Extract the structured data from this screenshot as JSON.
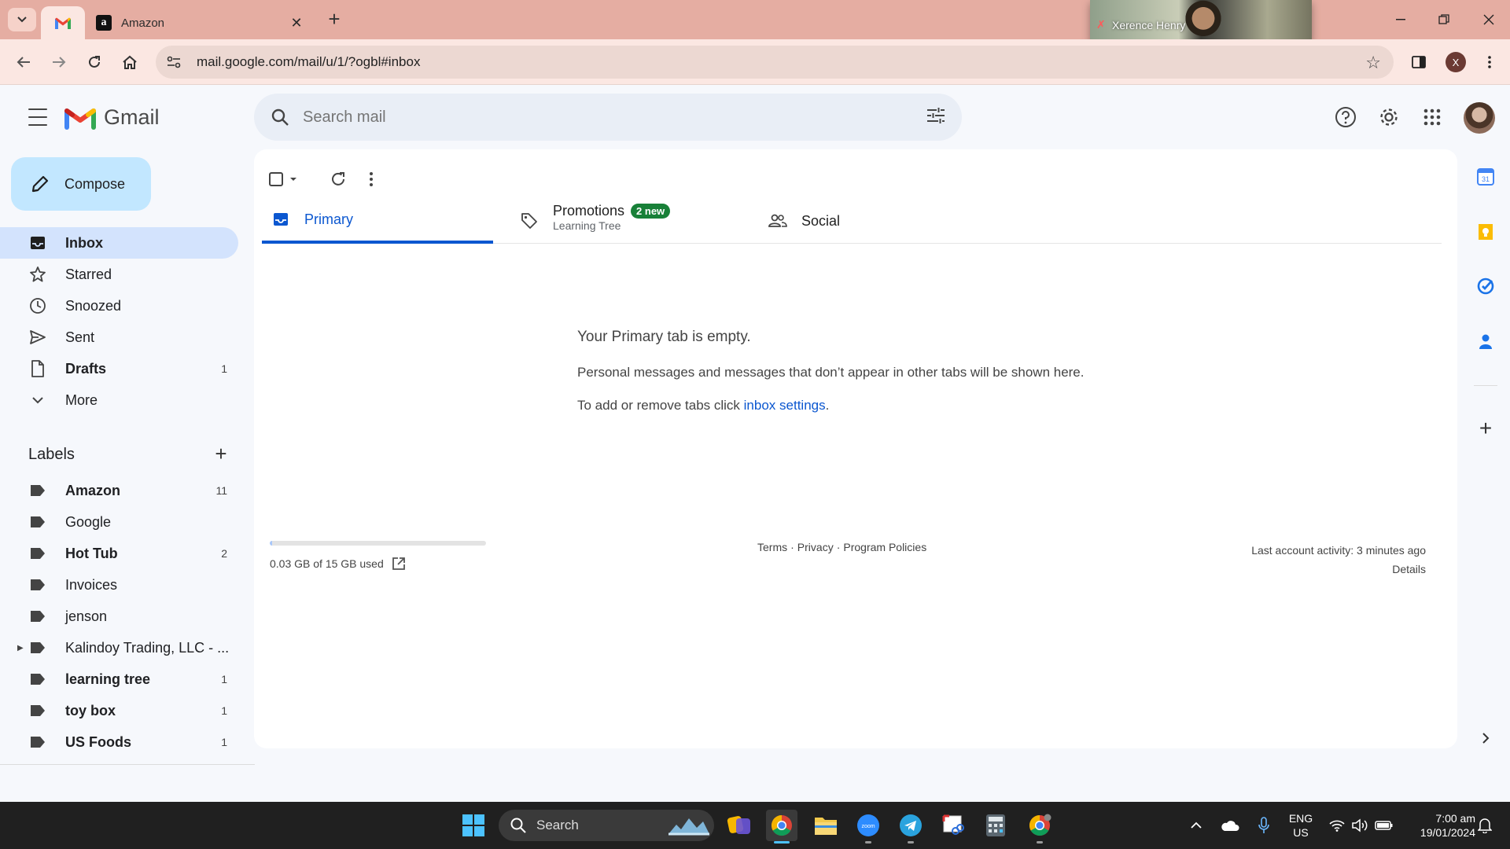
{
  "browser": {
    "tabs": [
      {
        "title": "",
        "favicon": "gmail-icon",
        "active": true
      },
      {
        "title": "Amazon",
        "favicon": "amazon-icon",
        "active": false
      }
    ],
    "new_tab": "+",
    "url": "mail.google.com/mail/u/1/?ogbl#inbox",
    "profile_initial": "X",
    "video_call_name": "Xerence Henry"
  },
  "gmail": {
    "logo_text": "Gmail",
    "search_placeholder": "Search mail",
    "compose_label": "Compose",
    "nav": [
      {
        "label": "Inbox",
        "count": "",
        "icon": "inbox-icon",
        "active": true,
        "bold": true
      },
      {
        "label": "Starred",
        "count": "",
        "icon": "star-icon",
        "active": false,
        "bold": false
      },
      {
        "label": "Snoozed",
        "count": "",
        "icon": "clock-icon",
        "active": false,
        "bold": false
      },
      {
        "label": "Sent",
        "count": "",
        "icon": "send-icon",
        "active": false,
        "bold": false
      },
      {
        "label": "Drafts",
        "count": "1",
        "icon": "draft-icon",
        "active": false,
        "bold": true
      },
      {
        "label": "More",
        "count": "",
        "icon": "chevron-down-icon",
        "active": false,
        "bold": false
      }
    ],
    "labels_title": "Labels",
    "labels": [
      {
        "label": "Amazon",
        "count": "11",
        "bold": true
      },
      {
        "label": "Google",
        "count": "",
        "bold": false
      },
      {
        "label": "Hot Tub",
        "count": "2",
        "bold": true
      },
      {
        "label": "Invoices",
        "count": "",
        "bold": false
      },
      {
        "label": "jenson",
        "count": "",
        "bold": false
      },
      {
        "label": "Kalindoy Trading, LLC - ...",
        "count": "",
        "bold": false,
        "expandable": true
      },
      {
        "label": "learning tree",
        "count": "1",
        "bold": true
      },
      {
        "label": "toy box",
        "count": "1",
        "bold": false
      },
      {
        "label": "US Foods",
        "count": "1",
        "bold": false
      }
    ],
    "category_tabs": [
      {
        "label": "Primary",
        "icon": "inbox-icon",
        "active": true
      },
      {
        "label": "Promotions",
        "icon": "tag-icon",
        "badge": "2 new",
        "subline": "Learning Tree"
      },
      {
        "label": "Social",
        "icon": "people-icon"
      }
    ],
    "empty_state": {
      "title": "Your Primary tab is empty.",
      "line1": "Personal messages and messages that don’t appear in other tabs will be shown here.",
      "line2_prefix": "To add or remove tabs click ",
      "line2_link": "inbox settings",
      "line2_suffix": "."
    },
    "footer": {
      "storage": "0.03 GB of 15 GB used",
      "storage_fraction": 0.002,
      "links": [
        "Terms",
        "Privacy",
        "Program Policies"
      ],
      "separator": "·",
      "activity": "Last account activity: 3 minutes ago",
      "details": "Details"
    }
  },
  "taskbar": {
    "search_label": "Search",
    "lang_top": "ENG",
    "lang_bottom": "US",
    "time": "7:00 am",
    "date": "19/01/2024"
  },
  "colors": {
    "tabstrip": "#e5ada2",
    "toolbar": "#fbe7e2",
    "compose": "#c2e7ff",
    "nav_active": "#d3e3fd",
    "primary_accent": "#0b57d0",
    "badge_green": "#188038"
  }
}
